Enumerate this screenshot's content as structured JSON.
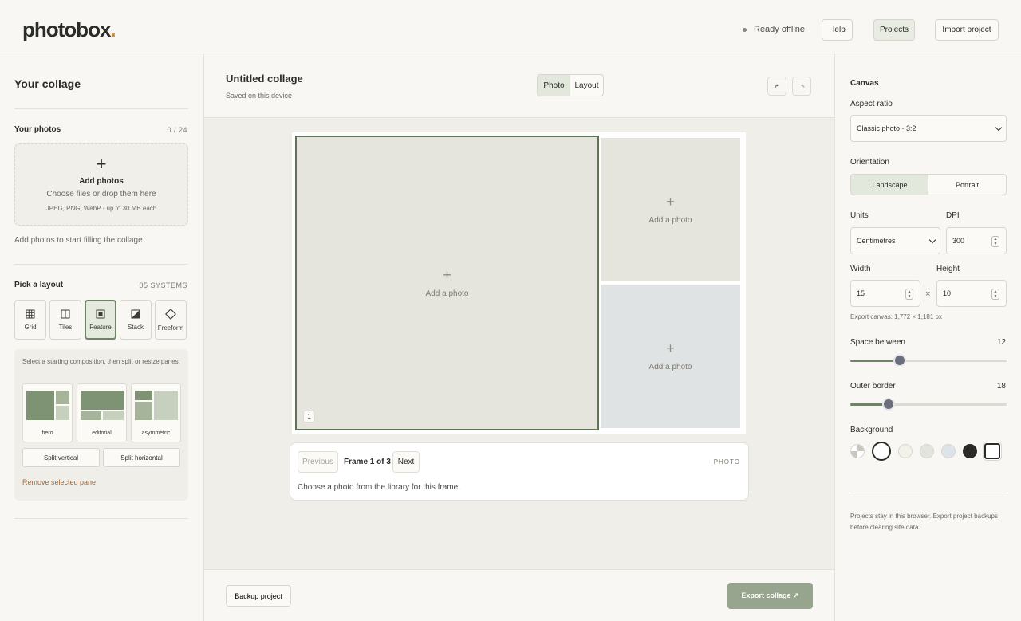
{
  "header": {
    "logo_text": "photobox",
    "logo_dot": ".",
    "status": "Ready offline",
    "help_label": "Help",
    "projects_label": "Projects",
    "import_label": "Import project"
  },
  "left": {
    "title": "Your collage",
    "photos_title": "Your photos",
    "photos_count": "0 / 24",
    "dropzone": {
      "plus": "+",
      "title": "Add photos",
      "subtitle": "Choose files or drop them here",
      "formats": "JPEG, PNG, WebP · up to 30 MB each"
    },
    "hint": "Add photos to start filling the collage.",
    "layout_title": "Pick a layout",
    "layout_count": "05 SYSTEMS",
    "layouts": [
      {
        "label": "Grid",
        "icon": "grid-icon"
      },
      {
        "label": "Tiles",
        "icon": "tiles-icon"
      },
      {
        "label": "Feature",
        "icon": "feature-icon"
      },
      {
        "label": "Stack",
        "icon": "stack-icon"
      },
      {
        "label": "Freeform",
        "icon": "freeform-icon"
      }
    ],
    "layout_desc": "Select a starting composition, then split or resize panes.",
    "presets": [
      {
        "label": "hero"
      },
      {
        "label": "editorial"
      },
      {
        "label": "asymmetric"
      }
    ],
    "split_vertical": "Split vertical",
    "split_horizontal": "Split horizontal",
    "remove_pane": "Remove selected pane"
  },
  "center": {
    "title": "Untitled collage",
    "subtitle": "Saved on this device",
    "mode_photo": "Photo",
    "mode_layout": "Layout",
    "undo_icon": "undo-icon",
    "redo_icon": "redo-icon",
    "panes": [
      {
        "plus": "+",
        "label": "Add a photo",
        "badge": "1"
      },
      {
        "plus": "+",
        "label": "Add a photo"
      },
      {
        "plus": "+",
        "label": "Add a photo"
      }
    ],
    "frame": {
      "previous": "Previous",
      "counter": "Frame 1 of 3",
      "next": "Next",
      "tag": "PHOTO",
      "desc": "Choose a photo from the library for this frame."
    },
    "backup_label": "Backup project",
    "export_label": "Export collage ↗"
  },
  "right": {
    "section_title": "Canvas",
    "aspect_label": "Aspect ratio",
    "aspect_value": "Classic photo · 3:2",
    "orientation_label": "Orientation",
    "landscape": "Landscape",
    "portrait": "Portrait",
    "units_label": "Units",
    "units_value": "Centimetres",
    "dpi_label": "DPI",
    "dpi_value": "300",
    "width_label": "Width",
    "width_value": "15",
    "height_label": "Height",
    "height_value": "10",
    "times": "×",
    "export_canvas": "Export canvas: 1,772 × 1,181 px",
    "space_label": "Space between",
    "space_value": "12",
    "border_label": "Outer border",
    "border_value": "18",
    "background_label": "Background",
    "swatch_colors": [
      "#ffffff",
      "#f2f1ea",
      "#e2e5de",
      "#dde3e8",
      "#2a2a28",
      "#ffffff"
    ],
    "note": "Projects stay in this browser. Export project backups before clearing site data."
  },
  "colors": {
    "accent": "#6f8366",
    "export_button": "#97a58f",
    "pane_warm": "#e6e5dd",
    "pane_cool": "#dfe3e3"
  }
}
